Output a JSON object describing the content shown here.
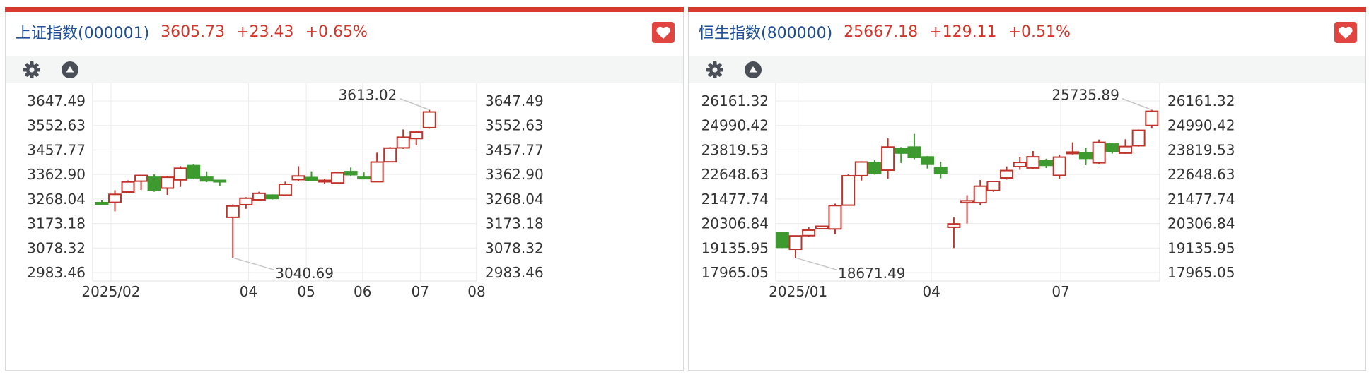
{
  "colors": {
    "up": "#c0332b",
    "down": "#3c9a2f",
    "accent": "#d93a30",
    "title": "#1f4f96",
    "grid": "#ececec"
  },
  "icons": [
    "settings-gear-icon",
    "collapse-triangle-icon",
    "favorite-heart-icon"
  ],
  "panels": [
    {
      "name": "上证指数(000001)",
      "price": "3605.73",
      "change": "+23.43",
      "change_pct": "+0.65%"
    },
    {
      "name": "恒生指数(800000)",
      "price": "25667.18",
      "change": "+129.11",
      "change_pct": "+0.51%"
    }
  ],
  "chart_data": [
    {
      "type": "candlestick",
      "title": "上证指数(000001)",
      "ylim": [
        2983.46,
        3647.49
      ],
      "y_ticks": [
        "3647.49",
        "3552.63",
        "3457.77",
        "3362.90",
        "3268.04",
        "3173.18",
        "3078.32",
        "2983.46"
      ],
      "y_tick_values": [
        3647.49,
        3552.63,
        3457.77,
        3362.9,
        3268.04,
        3173.18,
        3078.32,
        2983.46
      ],
      "x_ticks": [
        {
          "label": "2025/02",
          "index": 0.7
        },
        {
          "label": "04",
          "index": 11.2
        },
        {
          "label": "05",
          "index": 15.6
        },
        {
          "label": "06",
          "index": 19.9
        },
        {
          "label": "07",
          "index": 24.3
        },
        {
          "label": "08",
          "index": 28.6
        }
      ],
      "x_range": [
        -0.7,
        28.6
      ],
      "candles": [
        {
          "o": 3254,
          "c": 3253,
          "h": 3265,
          "l": 3252
        },
        {
          "o": 3255,
          "c": 3286,
          "h": 3302,
          "l": 3220
        },
        {
          "o": 3295,
          "c": 3334,
          "h": 3340,
          "l": 3290
        },
        {
          "o": 3337,
          "c": 3359,
          "h": 3362,
          "l": 3303
        },
        {
          "o": 3352,
          "c": 3303,
          "h": 3363,
          "l": 3296
        },
        {
          "o": 3310,
          "c": 3352,
          "h": 3356,
          "l": 3284
        },
        {
          "o": 3342,
          "c": 3387,
          "h": 3395,
          "l": 3315
        },
        {
          "o": 3397,
          "c": 3350,
          "h": 3404,
          "l": 3345
        },
        {
          "o": 3352,
          "c": 3338,
          "h": 3375,
          "l": 3333
        },
        {
          "o": 3340,
          "c": 3336,
          "h": 3340,
          "l": 3318
        },
        {
          "o": 3197,
          "c": 3241,
          "h": 3247,
          "l": 3041
        },
        {
          "o": 3246,
          "c": 3271,
          "h": 3275,
          "l": 3230
        },
        {
          "o": 3265,
          "c": 3290,
          "h": 3296,
          "l": 3262
        },
        {
          "o": 3283,
          "c": 3270,
          "h": 3286,
          "l": 3266
        },
        {
          "o": 3283,
          "c": 3325,
          "h": 3335,
          "l": 3279
        },
        {
          "o": 3343,
          "c": 3357,
          "h": 3395,
          "l": 3336
        },
        {
          "o": 3351,
          "c": 3339,
          "h": 3375,
          "l": 3337
        },
        {
          "o": 3336,
          "c": 3340,
          "h": 3346,
          "l": 3328
        },
        {
          "o": 3330,
          "c": 3370,
          "h": 3374,
          "l": 3328
        },
        {
          "o": 3374,
          "c": 3362,
          "h": 3390,
          "l": 3356
        },
        {
          "o": 3352,
          "c": 3349,
          "h": 3371,
          "l": 3345
        },
        {
          "o": 3335,
          "c": 3411,
          "h": 3447,
          "l": 3333
        },
        {
          "o": 3412,
          "c": 3465,
          "h": 3469,
          "l": 3410
        },
        {
          "o": 3466,
          "c": 3507,
          "h": 3537,
          "l": 3462
        },
        {
          "o": 3502,
          "c": 3527,
          "h": 3531,
          "l": 3475
        },
        {
          "o": 3544,
          "c": 3605,
          "h": 3613.02,
          "l": 3540
        }
      ],
      "annotations": [
        {
          "text": "3613.02",
          "index": 25,
          "value": 3613.02,
          "side": "above"
        },
        {
          "text": "3040.69",
          "index": 10,
          "value": 3040.69,
          "side": "below"
        }
      ]
    },
    {
      "type": "candlestick",
      "title": "恒生指数(800000)",
      "ylim": [
        17965.05,
        26161.32
      ],
      "y_ticks": [
        "26161.32",
        "24990.42",
        "23819.53",
        "22648.63",
        "21477.74",
        "20306.84",
        "19135.95",
        "17965.05"
      ],
      "y_tick_values": [
        26161.32,
        24990.42,
        23819.53,
        22648.63,
        21477.74,
        20306.84,
        19135.95,
        17965.05
      ],
      "x_ticks": [
        {
          "label": "2025/01",
          "index": 1.2
        },
        {
          "label": "04",
          "index": 11.3
        },
        {
          "label": "07",
          "index": 21.1
        }
      ],
      "x_range": [
        -0.5,
        28.6
      ],
      "candles": [
        {
          "o": 19885,
          "c": 19169,
          "h": 19917,
          "l": 19135
        },
        {
          "o": 19076,
          "c": 19713,
          "h": 19739,
          "l": 18671.49
        },
        {
          "o": 19727,
          "c": 19990,
          "h": 20131,
          "l": 19665
        },
        {
          "o": 20055,
          "c": 20174,
          "h": 20204,
          "l": 20043
        },
        {
          "o": 20046,
          "c": 21161,
          "h": 21253,
          "l": 19801
        },
        {
          "o": 21183,
          "c": 22584,
          "h": 22652,
          "l": 21181
        },
        {
          "o": 22590,
          "c": 23244,
          "h": 23282,
          "l": 22361
        },
        {
          "o": 23214,
          "c": 22717,
          "h": 23330,
          "l": 22638
        },
        {
          "o": 22855,
          "c": 23960,
          "h": 24370,
          "l": 22441
        },
        {
          "o": 23890,
          "c": 23672,
          "h": 23956,
          "l": 23197
        },
        {
          "o": 23958,
          "c": 23462,
          "h": 24585,
          "l": 23379
        },
        {
          "o": 23487,
          "c": 23135,
          "h": 23530,
          "l": 22934
        },
        {
          "o": 22977,
          "c": 22689,
          "h": 23254,
          "l": 22465
        },
        {
          "o": 20127,
          "c": 20287,
          "h": 20590,
          "l": 19135
        },
        {
          "o": 21301,
          "c": 21393,
          "h": 21658,
          "l": 20305
        },
        {
          "o": 21301,
          "c": 22090,
          "h": 22383,
          "l": 21177
        },
        {
          "o": 21884,
          "c": 22316,
          "h": 22338,
          "l": 21819
        },
        {
          "o": 22484,
          "c": 22837,
          "h": 23034,
          "l": 22402
        },
        {
          "o": 23023,
          "c": 23224,
          "h": 23467,
          "l": 22873
        },
        {
          "o": 22962,
          "c": 23492,
          "h": 23766,
          "l": 22889
        },
        {
          "o": 23327,
          "c": 23084,
          "h": 23401,
          "l": 22956
        },
        {
          "o": 22606,
          "c": 23477,
          "h": 23586,
          "l": 22443
        },
        {
          "o": 23697,
          "c": 23719,
          "h": 24185,
          "l": 23604
        },
        {
          "o": 23670,
          "c": 23418,
          "h": 23929,
          "l": 23093
        },
        {
          "o": 23207,
          "c": 24184,
          "h": 24316,
          "l": 23127
        },
        {
          "o": 24101,
          "c": 23747,
          "h": 24154,
          "l": 23644
        },
        {
          "o": 23670,
          "c": 23982,
          "h": 24331,
          "l": 23636
        },
        {
          "o": 24022,
          "c": 24758,
          "h": 24795,
          "l": 23979
        },
        {
          "o": 24990,
          "c": 25667.18,
          "h": 25735.89,
          "l": 24839
        }
      ],
      "annotations": [
        {
          "text": "25735.89",
          "index": 28,
          "value": 25735.89,
          "side": "above"
        },
        {
          "text": "18671.49",
          "index": 1,
          "value": 18671.49,
          "side": "below"
        }
      ]
    }
  ]
}
